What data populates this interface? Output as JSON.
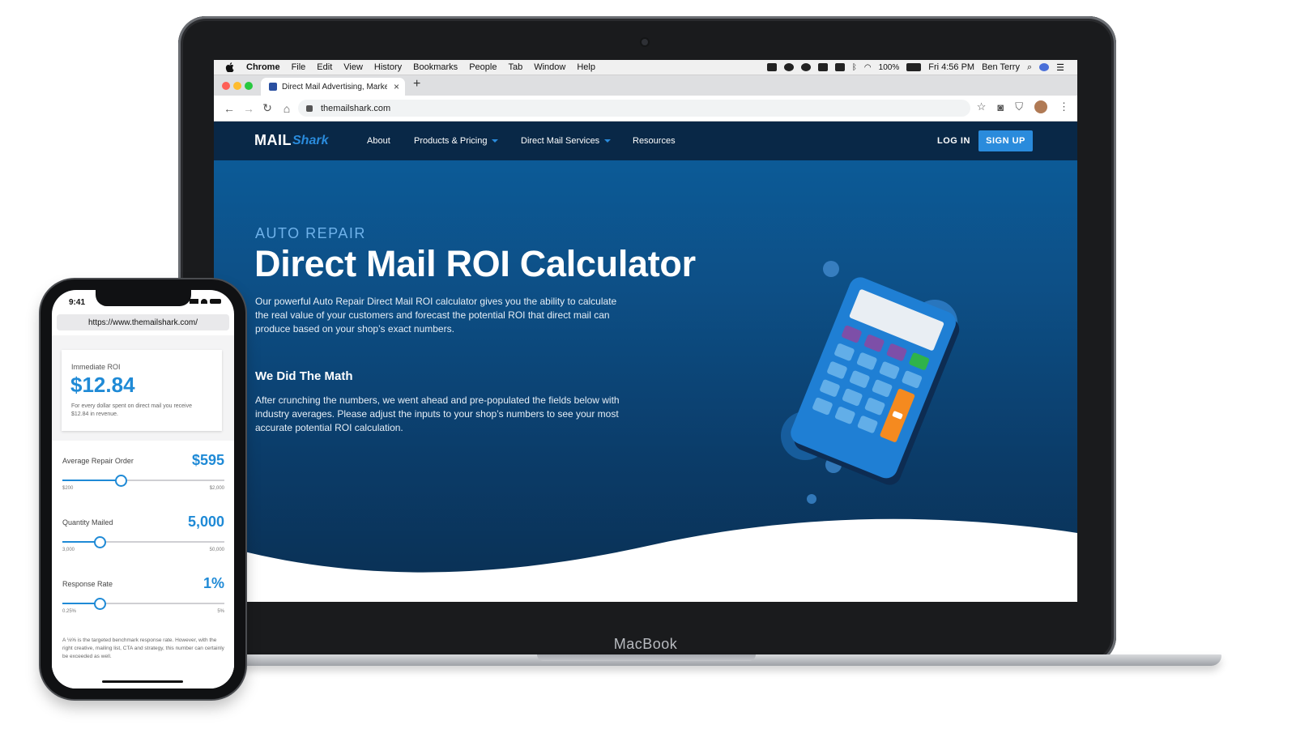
{
  "mac_menubar": {
    "app": "Chrome",
    "items": [
      "File",
      "Edit",
      "View",
      "History",
      "Bookmarks",
      "People",
      "Tab",
      "Window",
      "Help"
    ],
    "battery": "100%",
    "clock": "Fri 4:56 PM",
    "user": "Ben Terry"
  },
  "browser": {
    "tab_title": "Direct Mail Advertising, Marketing",
    "new_tab": "+",
    "close_tab": "×",
    "url": "themailshark.com"
  },
  "site": {
    "logo_mail": "MAIL",
    "logo_shark": "Shark",
    "nav": {
      "about": "About",
      "products": "Products & Pricing",
      "services": "Direct Mail Services",
      "resources": "Resources",
      "login": "LOG IN",
      "signup": "SIGN UP"
    },
    "hero": {
      "eyebrow": "AUTO REPAIR",
      "title": "Direct Mail ROI Calculator",
      "intro": "Our powerful Auto Repair Direct Mail ROI calculator gives you the ability to calculate the real value of your customers and forecast the potential ROI that direct mail can produce based on your shop’s exact numbers.",
      "subhead": "We Did The Math",
      "body": "After crunching the numbers, we went ahead and pre-populated the fields below with industry averages. Please adjust the inputs to your shop’s numbers to see your most accurate potential ROI calculation."
    }
  },
  "laptop": {
    "brand": "MacBook"
  },
  "phone": {
    "time": "9:41",
    "url": "https://www.themailshark.com/",
    "roi": {
      "label": "Immediate ROI",
      "value": "$12.84",
      "caption": "For every dollar spent on direct mail you receive $12.84 in revenue."
    },
    "fields": [
      {
        "label": "Average Repair Order",
        "value": "$595",
        "min": "$200",
        "max": "$2,000",
        "fraction": 0.36
      },
      {
        "label": "Quantity Mailed",
        "value": "5,000",
        "min": "3,000",
        "max": "50,000",
        "fraction": 0.23
      },
      {
        "label": "Response Rate",
        "value": "1%",
        "min": "0.25%",
        "max": "5%",
        "fraction": 0.23
      }
    ],
    "note": "A ⅛% is the targeted benchmark response rate. However, with the right creative, mailing list, CTA and strategy, this number can certainly be exceeded as well."
  },
  "colors": {
    "accent": "#2a8bdc",
    "nav_bg": "#092847",
    "hero_top": "#0c5e9c",
    "hero_bottom": "#0a2f52",
    "phone_accent": "#1f8ad6"
  }
}
